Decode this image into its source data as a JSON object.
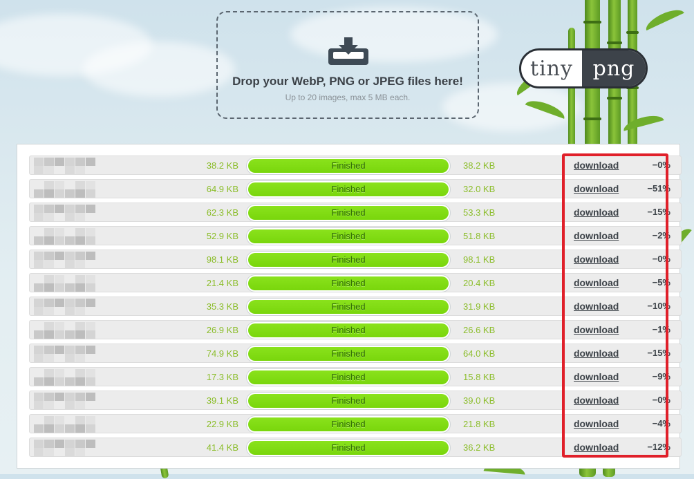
{
  "dropzone": {
    "title": "Drop your WebP, PNG or JPEG files here!",
    "subtitle": "Up to 20 images, max 5 MB each.",
    "icon": "download-tray-icon"
  },
  "logo": {
    "left": "tiny",
    "right": "png"
  },
  "files": [
    {
      "original": "38.2 KB",
      "status": "Finished",
      "compressed": "38.2 KB",
      "action": "download",
      "saving": "−0%"
    },
    {
      "original": "64.9 KB",
      "status": "Finished",
      "compressed": "32.0 KB",
      "action": "download",
      "saving": "−51%"
    },
    {
      "original": "62.3 KB",
      "status": "Finished",
      "compressed": "53.3 KB",
      "action": "download",
      "saving": "−15%"
    },
    {
      "original": "52.9 KB",
      "status": "Finished",
      "compressed": "51.8 KB",
      "action": "download",
      "saving": "−2%"
    },
    {
      "original": "98.1 KB",
      "status": "Finished",
      "compressed": "98.1 KB",
      "action": "download",
      "saving": "−0%"
    },
    {
      "original": "21.4 KB",
      "status": "Finished",
      "compressed": "20.4 KB",
      "action": "download",
      "saving": "−5%"
    },
    {
      "original": "35.3 KB",
      "status": "Finished",
      "compressed": "31.9 KB",
      "action": "download",
      "saving": "−10%"
    },
    {
      "original": "26.9 KB",
      "status": "Finished",
      "compressed": "26.6 KB",
      "action": "download",
      "saving": "−1%"
    },
    {
      "original": "74.9 KB",
      "status": "Finished",
      "compressed": "64.0 KB",
      "action": "download",
      "saving": "−15%"
    },
    {
      "original": "17.3 KB",
      "status": "Finished",
      "compressed": "15.8 KB",
      "action": "download",
      "saving": "−9%"
    },
    {
      "original": "39.1 KB",
      "status": "Finished",
      "compressed": "39.0 KB",
      "action": "download",
      "saving": "−0%"
    },
    {
      "original": "22.9 KB",
      "status": "Finished",
      "compressed": "21.8 KB",
      "action": "download",
      "saving": "−4%"
    },
    {
      "original": "41.4 KB",
      "status": "Finished",
      "compressed": "36.2 KB",
      "action": "download",
      "saving": "−12%"
    }
  ],
  "colors": {
    "progress": "#7fdc12",
    "size_text": "#8bbd2a",
    "highlight": "#e0202a"
  }
}
